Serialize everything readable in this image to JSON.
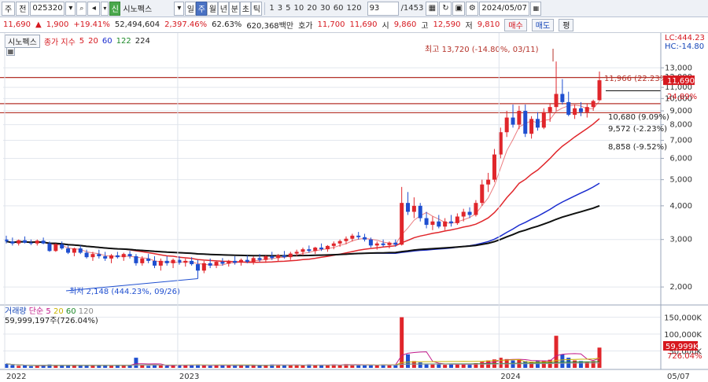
{
  "toolbar": {
    "menu_label": "주",
    "type_label": "전",
    "code": "025320",
    "stock_badge": "신",
    "stock_name": "시노펙스",
    "periods": [
      "일",
      "주",
      "월",
      "년",
      "분",
      "초",
      "틱"
    ],
    "active_period": "주",
    "intervals": [
      "1",
      "3",
      "5",
      "10",
      "20",
      "30",
      "60",
      "120"
    ],
    "count": "93",
    "count_total": "/1453",
    "date": "2024/05/07"
  },
  "quote": {
    "price": "11,690",
    "change": "1,900",
    "change_pct": "+19.41%",
    "volume": "52,494,604",
    "volume_pct": "2,397.46%",
    "turnover_ratio": "62.63%",
    "amount": "620,368백만",
    "ask_label": "호가",
    "ask": "11,700",
    "bid": "11,690",
    "open_label": "시",
    "open": "9,860",
    "high_label": "고",
    "high": "12,590",
    "low_label": "저",
    "low": "9,810",
    "buy_label": "매수",
    "sell_label": "매도",
    "eval_label": "평"
  },
  "legend": {
    "name": "시노펙스",
    "ma_title": "종가 지수",
    "ma": [
      "5",
      "20",
      "60",
      "122",
      "224"
    ]
  },
  "volume_legend": {
    "name": "거래량",
    "ma_title": "단순",
    "ma": [
      "5",
      "20",
      "60",
      "120"
    ],
    "value": "59,999,197주(726.04%)"
  },
  "scale_info": {
    "lc": "LC:444.23",
    "hc": "HC:-14.80"
  },
  "annotations": {
    "high": "최고 13,720 (-14.80%, 03/11)",
    "low": "최저 2,148 (444.23%, 09/26)",
    "r1": "11,966 (22.23%)",
    "r2": "24.89%",
    "r3": "10,680 (9.09%)",
    "r4": "9,572 (-2.23%)",
    "r5": "8,858 (-9.52%)"
  },
  "price_axis": [
    "13,000",
    "12,000",
    "11,000",
    "10,000",
    "9,000",
    "8,000",
    "7,000",
    "6,000",
    "5,000",
    "4,000",
    "3,000",
    "2,000"
  ],
  "current_price_tag": "11,690",
  "volume_axis": [
    "150,000K",
    "100,000K",
    "50,000K"
  ],
  "current_volume_tag": "59,999K",
  "current_volume_pct": "726.04%",
  "x_axis": [
    "2022",
    "2023",
    "2024",
    "05/07"
  ],
  "colors": {
    "up": "#e0262b",
    "down": "#1f4fd0",
    "ma5": "#e0262b",
    "ma20": "#e0262b",
    "ma60": "#1a2ccf",
    "ma122": "#1e8a2a",
    "ma224": "#111111",
    "hline": "#b5332a"
  },
  "chart_data": {
    "type": "candlestick",
    "y_scale": "log",
    "ylim": [
      1750,
      14500
    ],
    "horizontal_lines": [
      11966,
      9572,
      8858
    ],
    "candles": [
      [
        3000,
        3100,
        2900,
        2950
      ],
      [
        2950,
        3050,
        2850,
        2900
      ],
      [
        2900,
        3000,
        2850,
        2980
      ],
      [
        2980,
        3080,
        2900,
        2920
      ],
      [
        2920,
        3000,
        2860,
        2900
      ],
      [
        2900,
        3000,
        2850,
        2970
      ],
      [
        2970,
        3050,
        2880,
        2900
      ],
      [
        2900,
        2950,
        2700,
        2720
      ],
      [
        2720,
        2900,
        2700,
        2880
      ],
      [
        2880,
        2950,
        2750,
        2780
      ],
      [
        2780,
        2850,
        2650,
        2680
      ],
      [
        2680,
        2800,
        2600,
        2780
      ],
      [
        2780,
        2850,
        2650,
        2680
      ],
      [
        2680,
        2750,
        2550,
        2580
      ],
      [
        2580,
        2700,
        2500,
        2650
      ],
      [
        2650,
        2750,
        2550,
        2600
      ],
      [
        2600,
        2700,
        2500,
        2550
      ],
      [
        2550,
        2650,
        2450,
        2620
      ],
      [
        2620,
        2700,
        2550,
        2580
      ],
      [
        2580,
        2680,
        2500,
        2650
      ],
      [
        2650,
        2720,
        2550,
        2600
      ],
      [
        2600,
        2650,
        2400,
        2450
      ],
      [
        2450,
        2600,
        2400,
        2550
      ],
      [
        2550,
        2650,
        2450,
        2500
      ],
      [
        2500,
        2600,
        2350,
        2400
      ],
      [
        2400,
        2550,
        2300,
        2500
      ],
      [
        2500,
        2600,
        2400,
        2450
      ],
      [
        2450,
        2550,
        2350,
        2520
      ],
      [
        2520,
        2600,
        2420,
        2460
      ],
      [
        2460,
        2550,
        2380,
        2500
      ],
      [
        2500,
        2580,
        2400,
        2430
      ],
      [
        2430,
        2520,
        2148,
        2300
      ],
      [
        2300,
        2500,
        2250,
        2450
      ],
      [
        2450,
        2550,
        2350,
        2400
      ],
      [
        2400,
        2500,
        2350,
        2480
      ],
      [
        2480,
        2560,
        2400,
        2440
      ],
      [
        2440,
        2520,
        2380,
        2500
      ],
      [
        2500,
        2600,
        2420,
        2460
      ],
      [
        2460,
        2550,
        2400,
        2520
      ],
      [
        2520,
        2620,
        2450,
        2480
      ],
      [
        2480,
        2600,
        2420,
        2560
      ],
      [
        2560,
        2650,
        2480,
        2520
      ],
      [
        2520,
        2620,
        2460,
        2600
      ],
      [
        2600,
        2700,
        2520,
        2560
      ],
      [
        2560,
        2650,
        2500,
        2620
      ],
      [
        2620,
        2720,
        2550,
        2580
      ],
      [
        2580,
        2700,
        2520,
        2660
      ],
      [
        2660,
        2750,
        2600,
        2700
      ],
      [
        2700,
        2800,
        2620,
        2760
      ],
      [
        2760,
        2850,
        2680,
        2720
      ],
      [
        2720,
        2820,
        2650,
        2800
      ],
      [
        2800,
        2900,
        2720,
        2760
      ],
      [
        2760,
        2860,
        2700,
        2840
      ],
      [
        2840,
        2950,
        2760,
        2900
      ],
      [
        2900,
        3000,
        2820,
        2960
      ],
      [
        2960,
        3080,
        2880,
        3020
      ],
      [
        3020,
        3150,
        2950,
        3100
      ],
      [
        3100,
        3200,
        3000,
        3060
      ],
      [
        3060,
        3150,
        2950,
        3000
      ],
      [
        3000,
        3050,
        2800,
        2850
      ],
      [
        2850,
        2950,
        2750,
        2900
      ],
      [
        2900,
        3000,
        2820,
        2860
      ],
      [
        2860,
        2950,
        2780,
        2920
      ],
      [
        2920,
        3000,
        2820,
        2870
      ],
      [
        2870,
        4700,
        2850,
        4100
      ],
      [
        4100,
        4500,
        3700,
        3800
      ],
      [
        3800,
        4300,
        3600,
        4000
      ],
      [
        4000,
        4100,
        3500,
        3600
      ],
      [
        3600,
        3800,
        3300,
        3400
      ],
      [
        3400,
        3650,
        3250,
        3500
      ],
      [
        3500,
        3700,
        3300,
        3350
      ],
      [
        3350,
        3600,
        3250,
        3500
      ],
      [
        3500,
        3700,
        3350,
        3450
      ],
      [
        3450,
        3750,
        3400,
        3650
      ],
      [
        3650,
        3900,
        3500,
        3800
      ],
      [
        3800,
        3950,
        3600,
        3700
      ],
      [
        3700,
        4200,
        3650,
        4100
      ],
      [
        4100,
        5000,
        4000,
        4800
      ],
      [
        4800,
        5300,
        4500,
        5000
      ],
      [
        5000,
        6500,
        4900,
        6200
      ],
      [
        6200,
        7800,
        6000,
        7500
      ],
      [
        7500,
        9000,
        7200,
        8500
      ],
      [
        8500,
        9500,
        7800,
        8000
      ],
      [
        8000,
        9400,
        7700,
        9000
      ],
      [
        9000,
        9500,
        7200,
        7400
      ],
      [
        7400,
        8600,
        7100,
        8400
      ],
      [
        8400,
        8900,
        7600,
        7800
      ],
      [
        7800,
        9200,
        7700,
        8900
      ],
      [
        8900,
        9600,
        8200,
        9300
      ],
      [
        9300,
        13720,
        9000,
        10400
      ],
      [
        10400,
        11800,
        9500,
        9700
      ],
      [
        9700,
        10600,
        8600,
        8700
      ],
      [
        8700,
        9500,
        8400,
        9200
      ],
      [
        9200,
        9700,
        8600,
        8900
      ],
      [
        8900,
        9600,
        8500,
        9300
      ],
      [
        9300,
        9900,
        9000,
        9790
      ],
      [
        9860,
        12590,
        9810,
        11690
      ]
    ],
    "volume": [
      12,
      8,
      6,
      7,
      5,
      6,
      8,
      10,
      6,
      7,
      6,
      9,
      7,
      8,
      6,
      7,
      8,
      6,
      9,
      7,
      8,
      30,
      7,
      6,
      8,
      7,
      6,
      9,
      8,
      7,
      8,
      10,
      7,
      6,
      8,
      7,
      9,
      6,
      7,
      8,
      9,
      7,
      8,
      10,
      9,
      8,
      7,
      9,
      8,
      10,
      7,
      8,
      9,
      10,
      8,
      11,
      9,
      8,
      7,
      9,
      8,
      10,
      9,
      8,
      150,
      40,
      20,
      16,
      12,
      10,
      11,
      9,
      12,
      10,
      11,
      9,
      14,
      18,
      22,
      25,
      30,
      26,
      22,
      24,
      20,
      18,
      22,
      20,
      24,
      95,
      40,
      30,
      22,
      20,
      18,
      20,
      60
    ]
  }
}
